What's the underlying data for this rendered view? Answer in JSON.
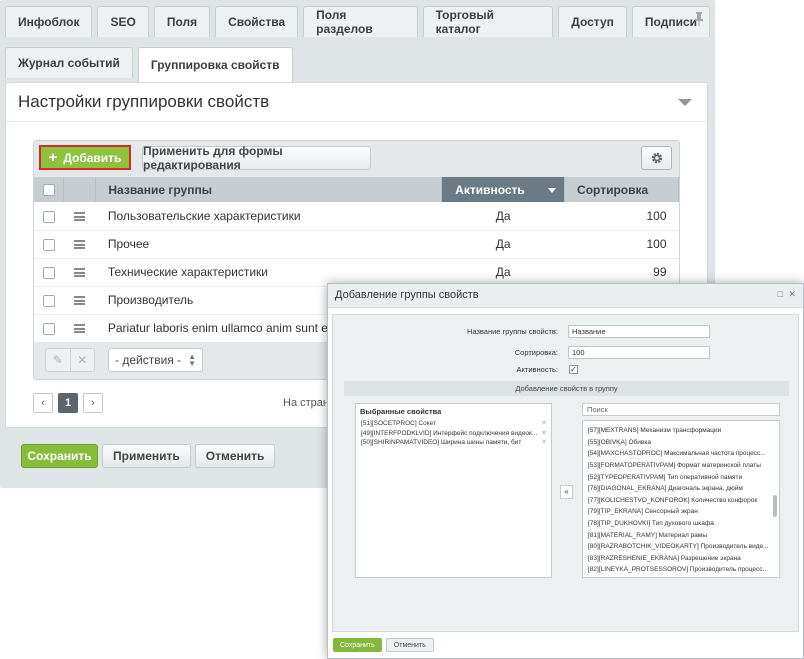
{
  "tabs_top": [
    "Инфоблок",
    "SEO",
    "Поля",
    "Свойства",
    "Поля разделов",
    "Торговый каталог",
    "Доступ",
    "Подписи"
  ],
  "tabs_second": [
    "Журнал событий",
    "Группировка свойств"
  ],
  "panel": {
    "title": "Настройки группировки свойств",
    "add_label": "Добавить",
    "apply_label": "Применить для формы редактирования",
    "columns": {
      "name": "Название группы",
      "active": "Активность",
      "sort": "Сортировка"
    },
    "rows": [
      {
        "name": "Пользовательские характеристики",
        "active": "Да",
        "sort": "100"
      },
      {
        "name": "Прочее",
        "active": "Да",
        "sort": "100"
      },
      {
        "name": "Технические характеристики",
        "active": "Да",
        "sort": "99"
      },
      {
        "name": "Производитель",
        "active": "",
        "sort": ""
      },
      {
        "name": "Pariatur laboris enim ullamco anim sunt enim. An",
        "active": "",
        "sort": ""
      }
    ],
    "actions_select": "- действия -",
    "pager_current": "1",
    "pager_text": "На страниц"
  },
  "buttons": {
    "save": "Сохранить",
    "apply": "Применить",
    "cancel": "Отменить"
  },
  "dialog": {
    "title": "Добавление группы свойств",
    "name_label": "Название группы свойств:",
    "name_value": "Название",
    "sort_label": "Сортировка:",
    "sort_value": "100",
    "active_label": "Активность:",
    "active_check": "✓",
    "section_title": "Добавление свойств в группу",
    "selected_title": "Выбранные свойства",
    "selected": [
      "[51][SOCETPROC] Сокет",
      "[49][INTERFPODKLVID] Интерфейс подключения видеок...",
      "[50][SHIRINPAMATVIDEO] Ширина шины памяти, бит"
    ],
    "move_label": "«",
    "search_placeholder": "Поиск",
    "available": [
      "[57][MEXTRANS] Механизм трансформации",
      "[55][OBIVKA] Обивка",
      "[54][MAXCHASTOPROC] Максимальная частота процесс...",
      "[53][FORMATOPERATIVPAM] Формат материнской платы",
      "[52][TYPEOPERATIVPAM] Тип оперативной памяти",
      "[76][DIAGONAL_EKRANA] Диагональ экрана, дюйм",
      "[77][KOLICHESTVO_KONFOROK] Количество конфорок",
      "[79][TIP_EKRANA] Сенсорный экран",
      "[78][TIP_DUKHOVKI] Тип духового шкафа",
      "[81][MATERIAL_RAMY] Материал рамы",
      "[80][RAZRABOTCHIK_VIDEOKARTY] Производитель виде...",
      "[83][RAZRESHENIE_EKRANA] Разрешение экрана",
      "[82][LINEYKA_PROTSESSOROV] Производитель процесс..."
    ],
    "save": "Сохранить",
    "cancel": "Отменить"
  },
  "colors": {
    "accent_green": "#86bd3b",
    "highlight_red": "#d32a2a",
    "header_active": "#6b7b85"
  }
}
